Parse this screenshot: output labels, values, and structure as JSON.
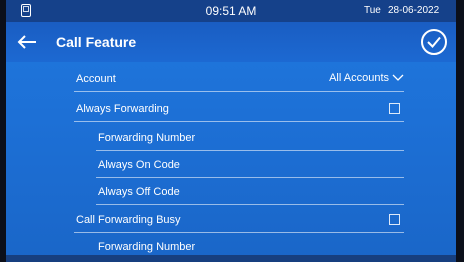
{
  "status": {
    "time": "09:51 AM",
    "day": "Tue",
    "date": "28-06-2022",
    "icon": "phone-screen-icon"
  },
  "header": {
    "title": "Call Feature",
    "back_icon": "arrow-left-icon",
    "confirm_icon": "check-circle-icon"
  },
  "settings": {
    "account_label": "Account",
    "account_value": "All Accounts",
    "always_forwarding_label": "Always Forwarding",
    "always_forwarding_checked": false,
    "forwarding_number_label": "Forwarding Number",
    "always_on_code_label": "Always On Code",
    "always_off_code_label": "Always Off Code",
    "call_forwarding_busy_label": "Call Forwarding Busy",
    "call_forwarding_busy_checked": false,
    "busy_forwarding_number_label": "Forwarding Number"
  },
  "colors": {
    "background": "#1d70d6",
    "statusbar": "#15418a",
    "text": "#ffffff"
  }
}
